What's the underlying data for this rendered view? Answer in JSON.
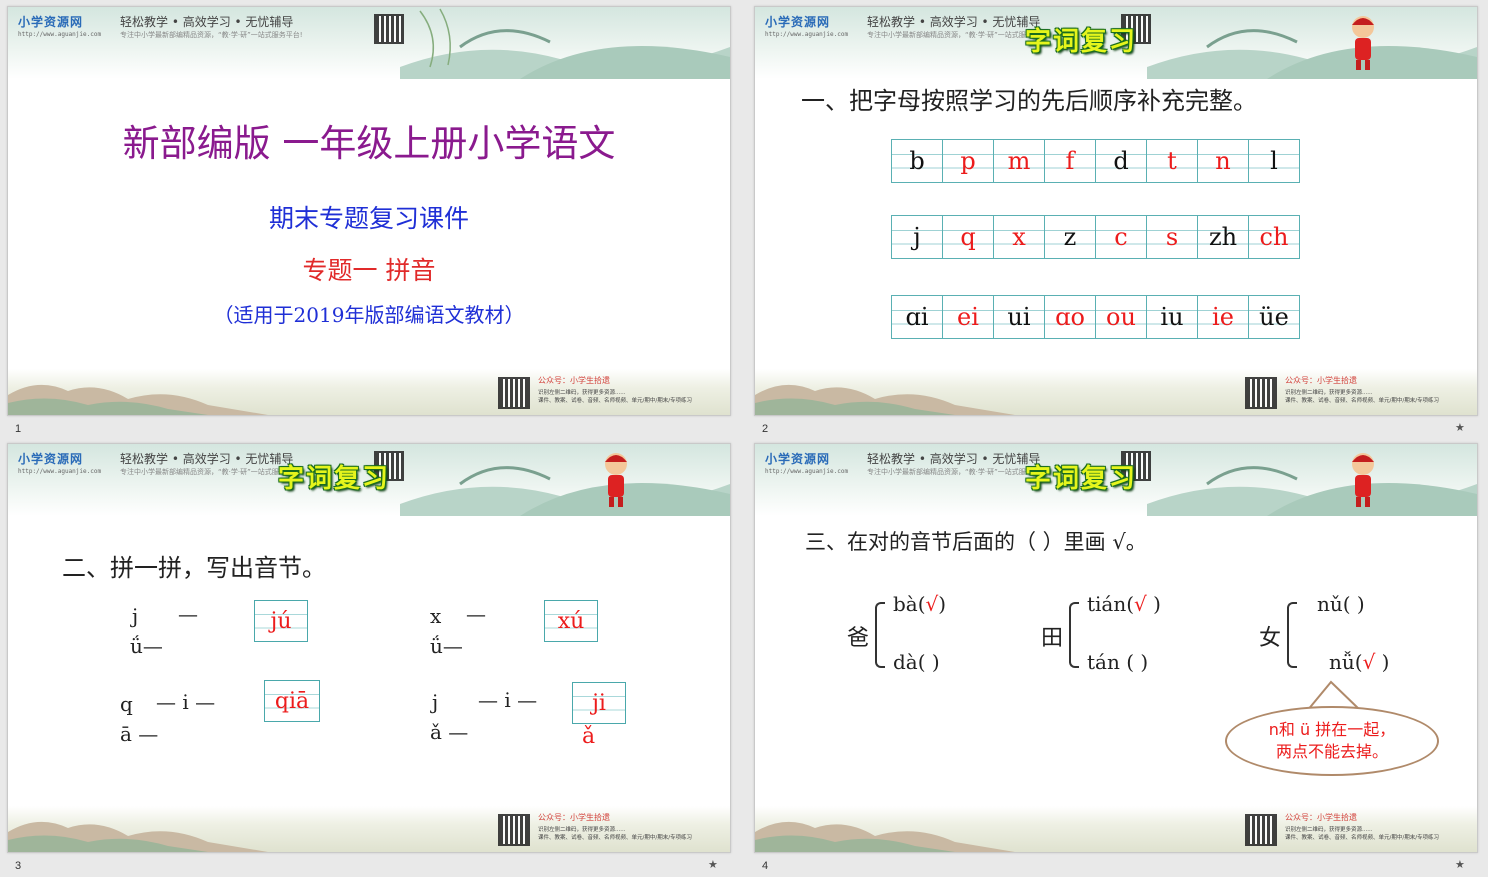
{
  "site": {
    "logo": "小学资源网",
    "url": "http://www.aguanjie.com",
    "slogan": "轻松教学 • 高效学习 • 无忧辅导",
    "sub_slogan": "专注中小学最新部编精品资源，“教·学·研”一站式服务平台!",
    "footer_line1": "公众号：小学生拾遗",
    "footer_line2": "识别左侧二维码，获得更多资源......",
    "footer_line3": "课件、教案、试卷、音频、名师视频、单元/期中/期末/专项练习"
  },
  "banner": "字词复习",
  "page_numbers": [
    "1",
    "2",
    "3",
    "4"
  ],
  "star_icon": "★",
  "slide1": {
    "title": "新部编版  一年级上册小学语文",
    "subtitle": "期末专题复习课件",
    "topic": "专题一    拼音",
    "note": "（适用于2019年版部编语文教材）"
  },
  "slide2": {
    "question": "一、把字母按照学习的先后顺序补充完整。",
    "rows": [
      [
        "b",
        "p",
        "m",
        "f",
        "d",
        "t",
        "n",
        "l"
      ],
      [
        "j",
        "q",
        "x",
        "z",
        "c",
        "s",
        "zh",
        "ch"
      ],
      [
        "ɑi",
        "ei",
        "ui",
        "ɑo",
        "ou",
        "iu",
        "ie",
        "üe"
      ]
    ],
    "red_flags": [
      [
        false,
        true,
        true,
        true,
        false,
        true,
        true,
        false
      ],
      [
        false,
        true,
        true,
        false,
        true,
        true,
        false,
        true
      ],
      [
        false,
        true,
        false,
        true,
        true,
        false,
        true,
        false
      ]
    ]
  },
  "slide3": {
    "question": "二、拼一拼，写出音节。",
    "items": [
      {
        "c": "j",
        "dash1": "—",
        "v": "ǘ—",
        "answer": "jú"
      },
      {
        "c": "x",
        "dash1": "—",
        "v": "ǘ—",
        "answer": "xú"
      },
      {
        "c": "q",
        "dash1": "— i —",
        "v": "ā —",
        "answer": "qiā"
      },
      {
        "c": "j",
        "dash1": "— i —",
        "v": "ǎ —",
        "answer": "ji",
        "tone": "ǎ"
      }
    ]
  },
  "slide4": {
    "question": "三、在对的音节后面的（     ）里画 √。",
    "groups": [
      {
        "hanzi": "爸",
        "top": "bà(",
        "top_mark": "√",
        "top_end": ")",
        "bottom": "dà(   )"
      },
      {
        "hanzi": "田",
        "top": "tián(",
        "top_mark": "√",
        "top_end": " )",
        "bottom": "tán (    )"
      },
      {
        "hanzi": "女",
        "top": "nǔ(    )",
        "bottom": "nǚ(",
        "bottom_mark": "√",
        "bottom_end": "  )"
      }
    ],
    "tip_line1": "n和 ü 拼在一起，",
    "tip_line2": "两点不能去掉。"
  }
}
